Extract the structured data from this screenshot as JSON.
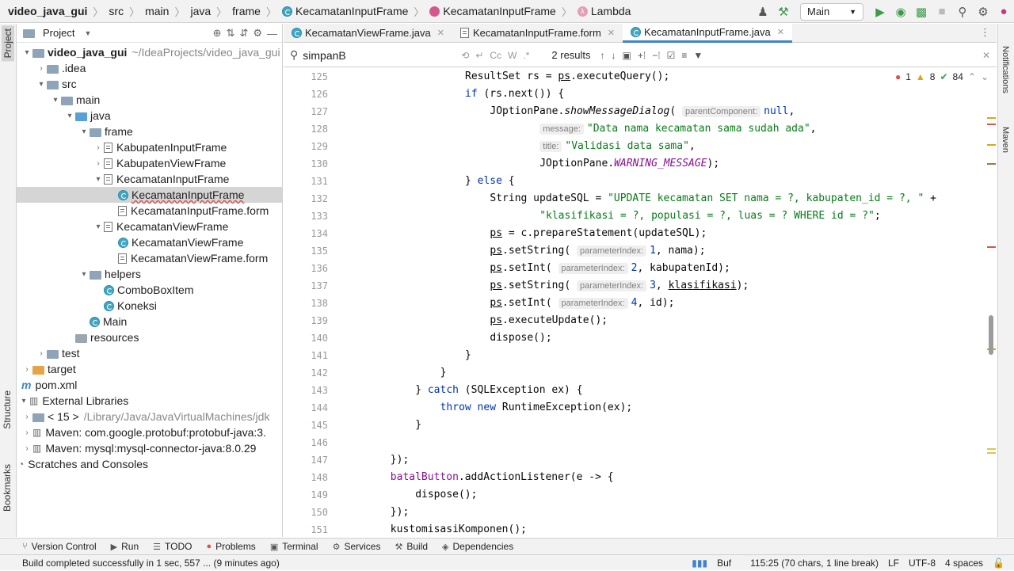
{
  "breadcrumbs": [
    "video_java_gui",
    "src",
    "main",
    "java",
    "frame",
    "KecamatanInputFrame",
    "KecamatanInputFrame",
    "Lambda"
  ],
  "run_config": "Main",
  "project_panel": {
    "title": "Project"
  },
  "tree": [
    {
      "label": "video_java_gui",
      "extra": "~/IdeaProjects/video_java_gui",
      "indent": 0,
      "arrow": "▾",
      "icon": "folder"
    },
    {
      "label": ".idea",
      "indent": 1,
      "arrow": "›",
      "icon": "folder"
    },
    {
      "label": "src",
      "indent": 1,
      "arrow": "▾",
      "icon": "folder"
    },
    {
      "label": "main",
      "indent": 2,
      "arrow": "▾",
      "icon": "folder"
    },
    {
      "label": "java",
      "indent": 3,
      "arrow": "▾",
      "icon": "folder-blue"
    },
    {
      "label": "frame",
      "indent": 4,
      "arrow": "▾",
      "icon": "folder"
    },
    {
      "label": "KabupatenInputFrame",
      "indent": 5,
      "arrow": "›",
      "icon": "form"
    },
    {
      "label": "KabupatenViewFrame",
      "indent": 5,
      "arrow": "›",
      "icon": "form"
    },
    {
      "label": "KecamatanInputFrame",
      "indent": 5,
      "arrow": "▾",
      "icon": "form"
    },
    {
      "label": "KecamatanInputFrame",
      "indent": 6,
      "arrow": "",
      "icon": "class",
      "selected": true
    },
    {
      "label": "KecamatanInputFrame.form",
      "indent": 6,
      "arrow": "",
      "icon": "form"
    },
    {
      "label": "KecamatanViewFrame",
      "indent": 5,
      "arrow": "▾",
      "icon": "form"
    },
    {
      "label": "KecamatanViewFrame",
      "indent": 6,
      "arrow": "",
      "icon": "class"
    },
    {
      "label": "KecamatanViewFrame.form",
      "indent": 6,
      "arrow": "",
      "icon": "form"
    },
    {
      "label": "helpers",
      "indent": 4,
      "arrow": "▾",
      "icon": "folder"
    },
    {
      "label": "ComboBoxItem",
      "indent": 5,
      "arrow": "",
      "icon": "class"
    },
    {
      "label": "Koneksi",
      "indent": 5,
      "arrow": "",
      "icon": "class"
    },
    {
      "label": "Main",
      "indent": 4,
      "arrow": "",
      "icon": "class"
    },
    {
      "label": "resources",
      "indent": 3,
      "arrow": "",
      "icon": "folder-grey"
    },
    {
      "label": "test",
      "indent": 1,
      "arrow": "›",
      "icon": "folder"
    },
    {
      "label": "target",
      "indent": 0,
      "arrow": "›",
      "icon": "folder-orange"
    },
    {
      "label": "pom.xml",
      "indent": 0,
      "arrow": "",
      "icon": "maven"
    },
    {
      "label": "External Libraries",
      "indent": -1,
      "arrow": "▾",
      "icon": "lib"
    },
    {
      "label": "< 15 >",
      "extra": "/Library/Java/JavaVirtualMachines/jdk",
      "indent": 0,
      "arrow": "›",
      "icon": "folder"
    },
    {
      "label": "Maven: com.google.protobuf:protobuf-java:3.",
      "indent": 0,
      "arrow": "›",
      "icon": "lib"
    },
    {
      "label": "Maven: mysql:mysql-connector-java:8.0.29",
      "indent": 0,
      "arrow": "›",
      "icon": "lib"
    },
    {
      "label": "Scratches and Consoles",
      "indent": -1,
      "arrow": "",
      "icon": "scratch"
    }
  ],
  "tabs": [
    {
      "label": "KecamatanViewFrame.java",
      "active": false
    },
    {
      "label": "KecamatanInputFrame.form",
      "active": false
    },
    {
      "label": "KecamatanInputFrame.java",
      "active": true
    }
  ],
  "find": {
    "query": "simpanB",
    "results": "2 results"
  },
  "inspections": {
    "errors": "1",
    "warnings": "8",
    "ok": "84"
  },
  "code_lines": [
    {
      "n": "125",
      "html": "<span>ResultSet rs = </span><span class='ul'>ps</span><span>.executeQuery();</span>",
      "indent": 7
    },
    {
      "n": "126",
      "html": "<span class='kw'>if</span> (rs.next()) {",
      "indent": 7
    },
    {
      "n": "127",
      "html": "JOptionPane.<span class='it'>showMessageDialog</span>( <span class='hint'>parentComponent:</span><span class='kw'>null</span>,",
      "indent": 8
    },
    {
      "n": "128",
      "html": "<span class='hint'>message:</span><span class='str'>\"Data nama kecamatan sama sudah ada\"</span>,",
      "indent": 10
    },
    {
      "n": "129",
      "html": "<span class='hint'>title:</span><span class='str'>\"Validasi data sama\"</span>,",
      "indent": 10
    },
    {
      "n": "130",
      "html": "JOptionPane.<span class='purple it'>WARNING_MESSAGE</span>);",
      "indent": 10
    },
    {
      "n": "131",
      "html": "} <span class='kw'>else</span> {",
      "indent": 7
    },
    {
      "n": "132",
      "html": "String updateSQL = <span class='str'>\"UPDATE kecamatan SET nama = ?, kabupaten_id = ?, \"</span> +",
      "indent": 8
    },
    {
      "n": "133",
      "html": "<span class='str'>\"klasifikasi = ?, populasi = ?, luas = ? WHERE id = ?\"</span>;",
      "indent": 10
    },
    {
      "n": "134",
      "html": "<span class='ul'>ps</span> = c.prepareStatement(updateSQL);",
      "indent": 8
    },
    {
      "n": "135",
      "html": "<span class='ul'>ps</span>.setString( <span class='hint'>parameterIndex:</span><span class='kw'>1</span>, nama);",
      "indent": 8
    },
    {
      "n": "136",
      "html": "<span class='ul'>ps</span>.setInt( <span class='hint'>parameterIndex:</span><span class='kw'>2</span>, kabupatenId);",
      "indent": 8
    },
    {
      "n": "137",
      "html": "<span class='ul'>ps</span>.setString( <span class='hint'>parameterIndex:</span><span class='kw'>3</span>, <span class='ul'>klasifikasi</span>);",
      "indent": 8
    },
    {
      "n": "138",
      "html": "<span class='ul'>ps</span>.setInt( <span class='hint'>parameterIndex:</span><span class='kw'>4</span>, id);",
      "indent": 8
    },
    {
      "n": "139",
      "html": "<span class='ul'>ps</span>.executeUpdate();",
      "indent": 8
    },
    {
      "n": "140",
      "html": "dispose();",
      "indent": 8
    },
    {
      "n": "141",
      "html": "}",
      "indent": 7
    },
    {
      "n": "142",
      "html": "}",
      "indent": 6
    },
    {
      "n": "143",
      "html": "} <span class='kw'>catch</span> (SQLException ex) {",
      "indent": 5
    },
    {
      "n": "144",
      "html": "<span class='kw'>throw new</span> RuntimeException(ex);",
      "indent": 6
    },
    {
      "n": "145",
      "html": "}",
      "indent": 5
    },
    {
      "n": "146",
      "html": "",
      "indent": 0
    },
    {
      "n": "147",
      "html": "});",
      "indent": 4
    },
    {
      "n": "148",
      "html": "<span class='purple'>batalButton</span>.addActionListener(e -&gt; {",
      "indent": 4
    },
    {
      "n": "149",
      "html": "dispose();",
      "indent": 5
    },
    {
      "n": "150",
      "html": "});",
      "indent": 4
    },
    {
      "n": "151",
      "html": "kustomisasiKomponen();",
      "indent": 4
    }
  ],
  "bottom_tabs": [
    "Version Control",
    "Run",
    "TODO",
    "Problems",
    "Terminal",
    "Services",
    "Build",
    "Dependencies"
  ],
  "status": {
    "message": "Build completed successfully in 1 sec, 557 ... (9 minutes ago)",
    "buf": "Buf",
    "position": "115:25 (70 chars, 1 line break)",
    "line_sep": "LF",
    "encoding": "UTF-8",
    "indent": "4 spaces"
  },
  "side_tabs": {
    "project": "Project",
    "structure": "Structure",
    "bookmarks": "Bookmarks",
    "notifications": "Notifications",
    "maven": "Maven"
  }
}
